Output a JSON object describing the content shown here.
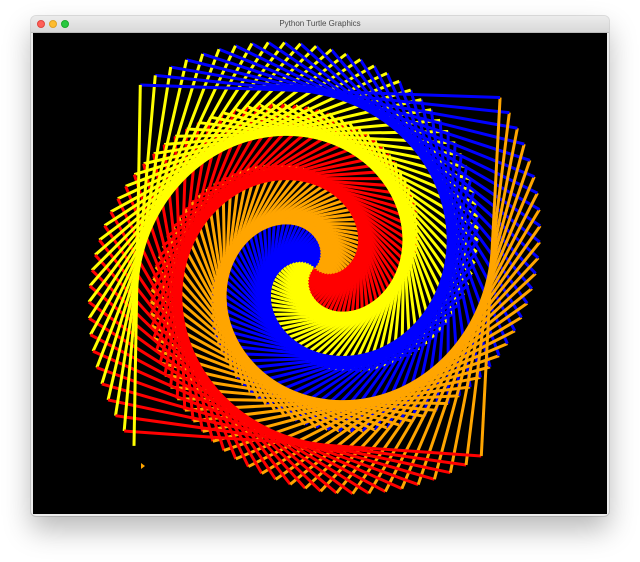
{
  "window": {
    "title": "Python Turtle Graphics"
  },
  "canvas": {
    "background": "#000000",
    "pen_colors": [
      "#ff0000",
      "#ffa500",
      "#0000ff",
      "#ffff00"
    ],
    "turtle_cursor_icon": "turtle-cursor"
  }
}
